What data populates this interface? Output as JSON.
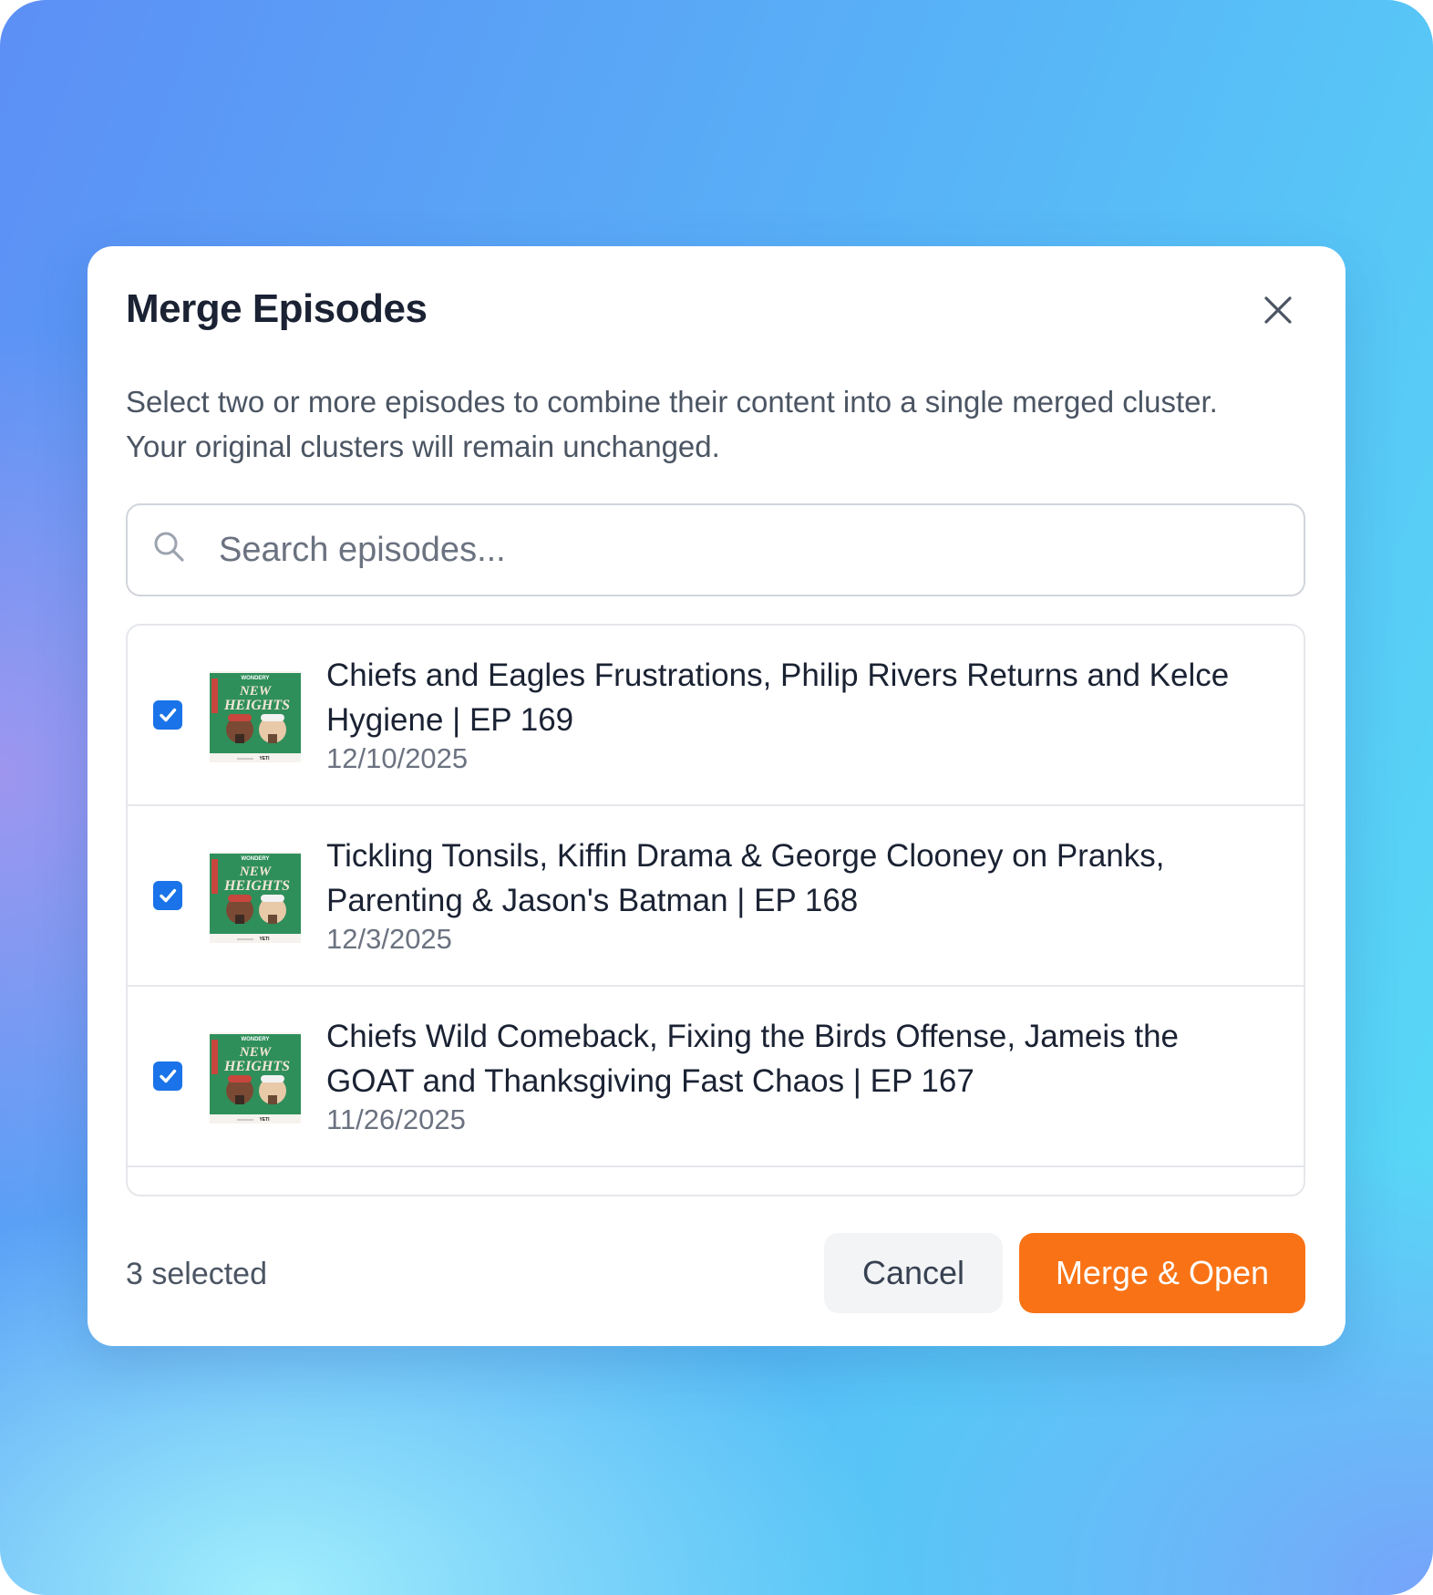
{
  "modal": {
    "title": "Merge Episodes",
    "description": "Select two or more episodes to combine their content into a single merged cluster. Your original clusters will remain unchanged."
  },
  "search": {
    "placeholder": "Search episodes..."
  },
  "episodes": [
    {
      "title": "Chiefs and Eagles Frustrations, Philip Rivers Returns and Kelce Hygiene | EP 169",
      "date": "12/10/2025",
      "checked": true,
      "thumbnail": {
        "brand": "WONDERY",
        "show": "NEW HEIGHTS",
        "sponsor": "YETI"
      }
    },
    {
      "title": "Tickling Tonsils, Kiffin Drama & George Clooney on Pranks, Parenting & Jason's Batman | EP 168",
      "date": "12/3/2025",
      "checked": true,
      "thumbnail": {
        "brand": "WONDERY",
        "show": "NEW HEIGHTS",
        "sponsor": "YETI"
      }
    },
    {
      "title": "Chiefs Wild Comeback, Fixing the Birds Offense, Jameis the GOAT and Thanksgiving Fast Chaos | EP 167",
      "date": "11/26/2025",
      "checked": true,
      "thumbnail": {
        "brand": "WONDERY",
        "show": "NEW HEIGHTS",
        "sponsor": "YETI"
      }
    }
  ],
  "footer": {
    "selected_count": "3 selected",
    "cancel_label": "Cancel",
    "merge_label": "Merge & Open"
  },
  "icons": {
    "close": "close-icon",
    "search": "search-icon",
    "checkbox": "checkmark-icon"
  },
  "colors": {
    "accent": "#f97316",
    "checkbox": "#1a73e8",
    "thumbnail_green": "#2f8f5b"
  }
}
